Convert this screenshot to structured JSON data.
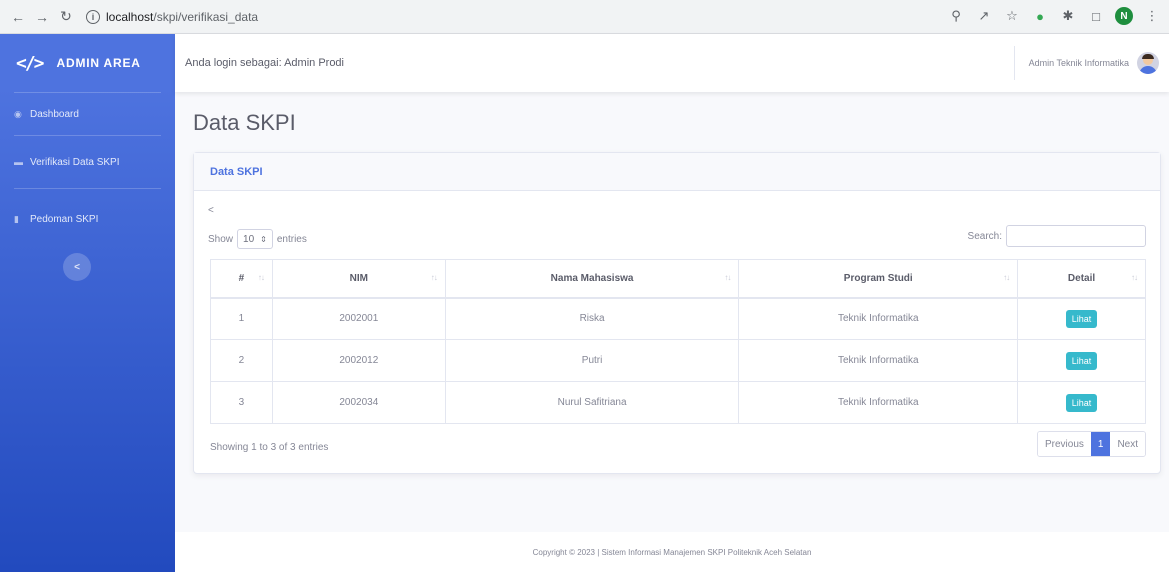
{
  "browser": {
    "url_host": "localhost",
    "url_path": "/skpi/verifikasi_data",
    "profile_initial": "N"
  },
  "sidebar": {
    "brand": "ADMIN AREA",
    "items": [
      {
        "label": "Dashboard",
        "icon": "dashboard-icon"
      },
      {
        "label": "Verifikasi Data SKPI",
        "icon": "folder-icon"
      },
      {
        "label": "Pedoman SKPI",
        "icon": "file-icon"
      }
    ]
  },
  "topbar": {
    "login_text": "Anda login sebagai: Admin Prodi",
    "user_name": "Admin Teknik Informatika"
  },
  "page": {
    "title": "Data SKPI"
  },
  "card": {
    "title": "Data SKPI",
    "prev_arrow": "<",
    "show_label": "Show",
    "entries_value": "10",
    "entries_label": "entries",
    "search_label": "Search:",
    "columns": [
      "#",
      "NIM",
      "Nama Mahasiswa",
      "Program Studi",
      "Detail"
    ],
    "rows": [
      {
        "no": "1",
        "nim": "2002001",
        "nama": "Riska",
        "prodi": "Teknik Informatika",
        "detail": "Lihat"
      },
      {
        "no": "2",
        "nim": "2002012",
        "nama": "Putri",
        "prodi": "Teknik Informatika",
        "detail": "Lihat"
      },
      {
        "no": "3",
        "nim": "2002034",
        "nama": "Nurul Safitriana",
        "prodi": "Teknik Informatika",
        "detail": "Lihat"
      }
    ],
    "info": "Showing 1 to 3 of 3 entries",
    "pagination": {
      "previous": "Previous",
      "current": "1",
      "next": "Next"
    }
  },
  "footer": {
    "text": "Copyright © 2023 | Sistem Informasi Manajemen SKPI Politeknik Aceh Selatan"
  },
  "colors": {
    "primary": "#4e73df",
    "info": "#36b9cc"
  }
}
